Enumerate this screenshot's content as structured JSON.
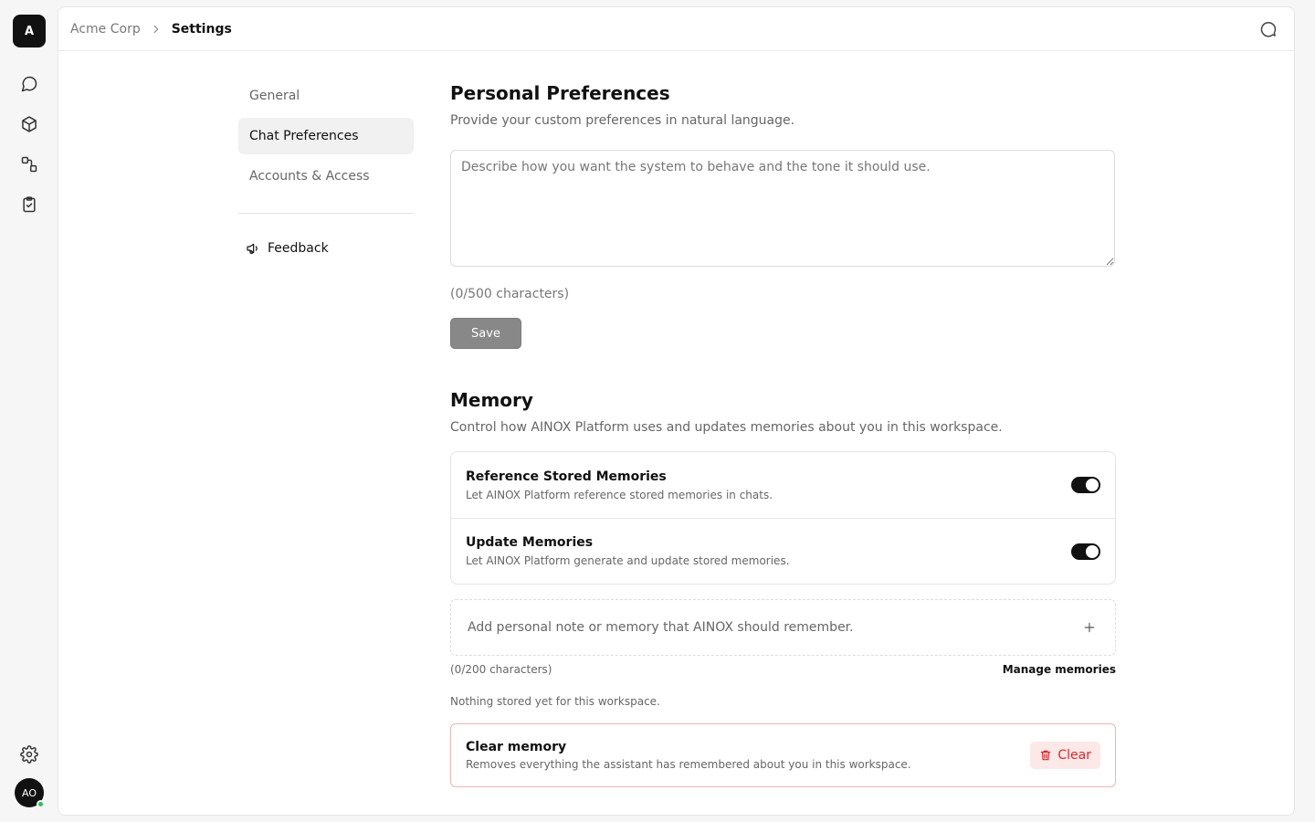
{
  "rail": {
    "workspace_initial": "A",
    "nav_icons": [
      "chat-bubble-icon",
      "cube-icon",
      "workflow-icon",
      "clipboard-check-icon"
    ],
    "avatar_initials": "AO"
  },
  "topbar": {
    "breadcrumb_root": "Acme Corp",
    "breadcrumb_current": "Settings"
  },
  "settings_nav": {
    "items": [
      {
        "label": "General",
        "active": false
      },
      {
        "label": "Chat Preferences",
        "active": true
      },
      {
        "label": "Accounts & Access",
        "active": false
      }
    ],
    "feedback_label": "Feedback"
  },
  "personal_preferences": {
    "title": "Personal Preferences",
    "subtitle": "Provide your custom preferences in natural language.",
    "placeholder": "Describe how you want the system to behave and the tone it should use.",
    "counter": "(0/500 characters)",
    "save_label": "Save"
  },
  "memory": {
    "title": "Memory",
    "subtitle": "Control how AINOX Platform uses and updates memories about you in this workspace.",
    "settings": [
      {
        "title": "Reference Stored Memories",
        "description": "Let AINOX Platform reference stored memories in chats.",
        "enabled": true
      },
      {
        "title": "Update Memories",
        "description": "Let AINOX Platform generate and update stored memories.",
        "enabled": true
      }
    ],
    "note_placeholder": "Add personal note or memory that AINOX should remember.",
    "note_counter": "(0/200 characters)",
    "manage_label": "Manage memories",
    "empty_state": "Nothing stored yet for this workspace.",
    "clear": {
      "title": "Clear memory",
      "description": "Removes everything the assistant has remembered about you in this workspace.",
      "button_label": "Clear"
    }
  },
  "colors": {
    "accent": "#111111",
    "danger": "#dc2626",
    "presence": "#22c55e"
  }
}
